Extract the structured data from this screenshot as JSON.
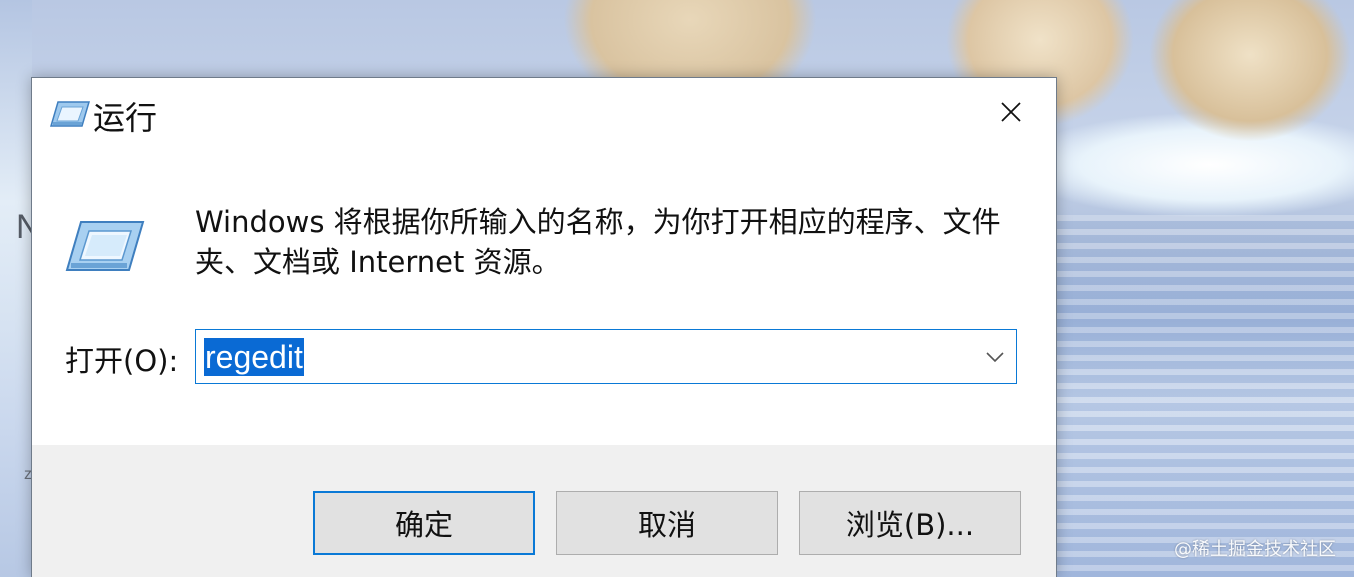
{
  "dialog": {
    "title": "运行",
    "description": "Windows 将根据你所输入的名称，为你打开相应的程序、文件夹、文档或 Internet 资源。",
    "open_label": "打开(O):",
    "input": {
      "value": "regedit"
    },
    "buttons": {
      "ok": "确定",
      "cancel": "取消",
      "browse": "浏览(B)..."
    }
  },
  "desktop": {
    "partial_text_1": "N",
    "partial_text_2": "z",
    "watermark": "@稀土掘金技术社区"
  },
  "colors": {
    "accent": "#0a79d6",
    "selection": "#0a6ad4",
    "footer_bg": "#f0f0f0",
    "button_bg": "#e1e1e1"
  },
  "icons": {
    "title": "run-icon",
    "body": "run-icon",
    "close": "close-icon",
    "dropdown": "chevron-down-icon"
  }
}
